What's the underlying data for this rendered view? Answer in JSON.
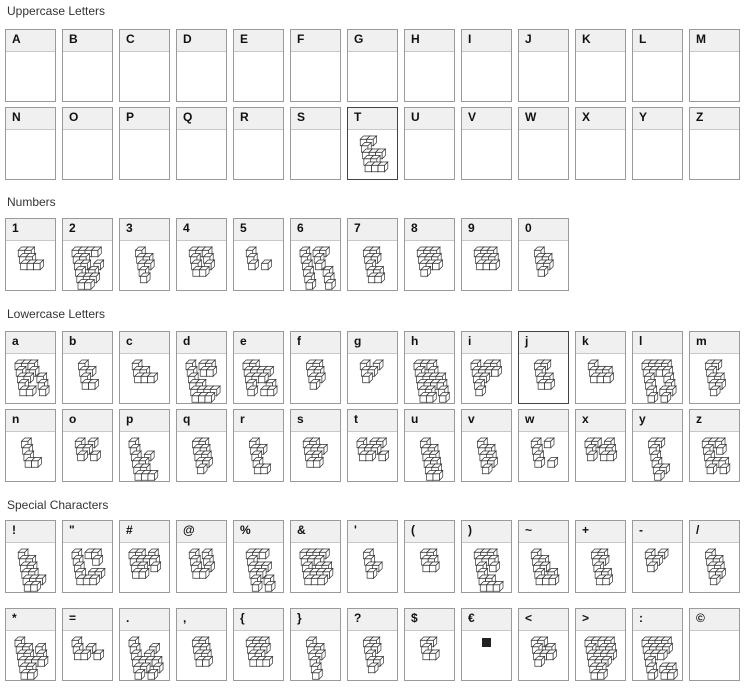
{
  "sections": [
    {
      "title": "Uppercase Letters",
      "rows": [
        [
          "A",
          "B",
          "C",
          "D",
          "E",
          "F",
          "G",
          "H",
          "I",
          "J",
          "K",
          "L",
          "M"
        ],
        [
          "N",
          "O",
          "P",
          "Q",
          "R",
          "S",
          "T",
          "U",
          "V",
          "W",
          "X",
          "Y",
          "Z"
        ]
      ]
    },
    {
      "title": "Numbers",
      "rows": [
        [
          "1",
          "2",
          "3",
          "4",
          "5",
          "6",
          "7",
          "8",
          "9",
          "0"
        ]
      ]
    },
    {
      "title": "Lowercase Letters",
      "rows": [
        [
          "a",
          "b",
          "c",
          "d",
          "e",
          "f",
          "g",
          "h",
          "i",
          "j",
          "k",
          "l",
          "m"
        ],
        [
          "n",
          "o",
          "p",
          "q",
          "r",
          "s",
          "t",
          "u",
          "v",
          "w",
          "x",
          "y",
          "z"
        ]
      ]
    },
    {
      "title": "Special Characters",
      "rows": [
        [
          "!",
          "\"",
          "#",
          "@",
          "%",
          "&",
          "'",
          "(",
          ")",
          "~",
          "+",
          "-",
          "/"
        ],
        [
          "*",
          "=",
          ".",
          ",",
          "{",
          "}",
          "?",
          "$",
          "€",
          "<",
          ">",
          ":",
          "©"
        ]
      ]
    }
  ],
  "selected_glyphs": [
    "T",
    "j"
  ],
  "empty_preview_glyphs": [
    "A",
    "B",
    "C",
    "D",
    "E",
    "F",
    "G",
    "H",
    "I",
    "J",
    "K",
    "L",
    "M",
    "N",
    "O",
    "P",
    "Q",
    "R",
    "S",
    "U",
    "V",
    "W",
    "X",
    "Y",
    "Z",
    "©"
  ],
  "filled_square_glyphs": [
    "€"
  ],
  "colors": {
    "border": "#9a9a9a",
    "header_bg": "#f0f0f0",
    "text": "#222222"
  }
}
